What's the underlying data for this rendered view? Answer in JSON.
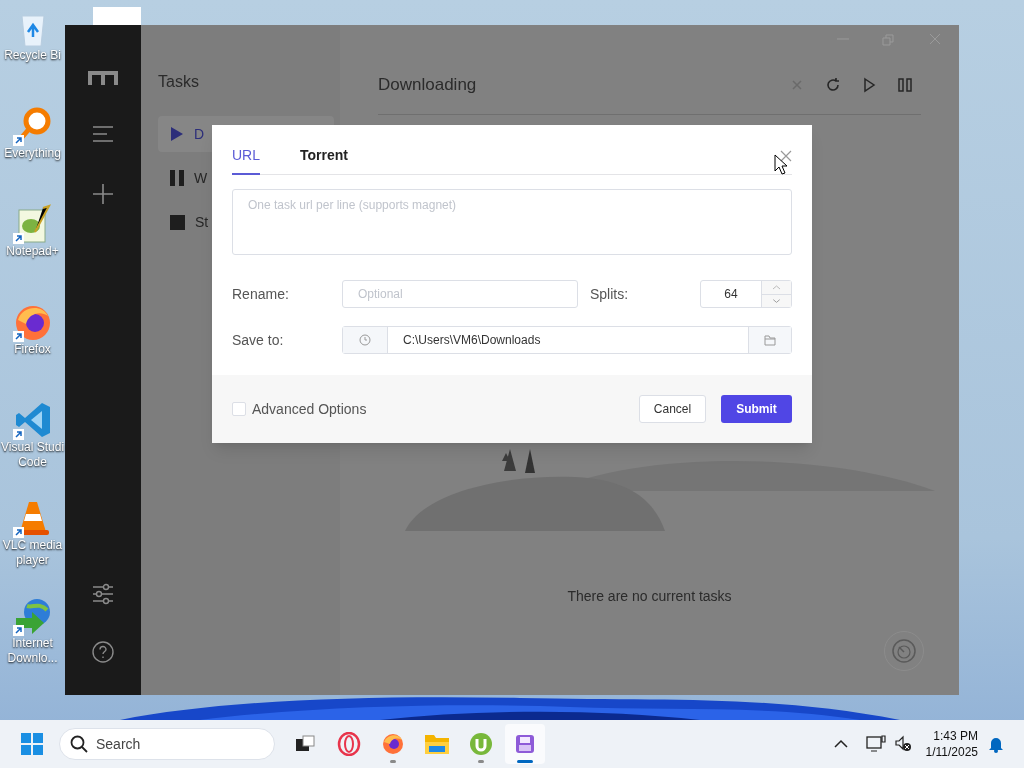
{
  "desktop": {
    "icons": [
      {
        "kind": "recycle",
        "lines": [
          "Recycle Bi"
        ],
        "shortcut": false
      },
      {
        "kind": "search",
        "lines": [
          "Everything"
        ],
        "shortcut": true
      },
      {
        "kind": "notepad",
        "lines": [
          "Notepad+"
        ],
        "shortcut": true
      },
      {
        "kind": "firefox",
        "lines": [
          "Firefox"
        ],
        "shortcut": true
      },
      {
        "kind": "vscode",
        "lines": [
          "Visual Studi",
          "Code"
        ],
        "shortcut": true
      },
      {
        "kind": "vlc",
        "lines": [
          "VLC media",
          "player"
        ],
        "shortcut": true
      },
      {
        "kind": "idm",
        "lines": [
          "Internet",
          "Downlo..."
        ],
        "shortcut": true
      }
    ]
  },
  "window": {
    "task_list": {
      "title": "Tasks",
      "items": [
        {
          "kind": "play",
          "label": "D",
          "selected": true
        },
        {
          "kind": "pause",
          "label": "W",
          "selected": false
        },
        {
          "kind": "stop",
          "label": "St",
          "selected": false
        }
      ]
    },
    "main": {
      "title": "Downloading",
      "empty_text": "There are no current tasks"
    }
  },
  "dialog": {
    "tabs": [
      {
        "label": "URL",
        "selected": true
      },
      {
        "label": "Torrent",
        "selected": false
      }
    ],
    "url_placeholder": "One task url per line (supports magnet)",
    "rename": {
      "label": "Rename:",
      "placeholder": "Optional"
    },
    "splits": {
      "label": "Splits:",
      "value": "64"
    },
    "save_to": {
      "label": "Save to:",
      "value": "C:\\Users\\VM6\\Downloads"
    },
    "advanced": {
      "label": "Advanced Options",
      "checked": false
    },
    "cancel": "Cancel",
    "submit": "Submit"
  },
  "taskbar": {
    "search_placeholder": "Search",
    "apps": [
      {
        "kind": "taskview",
        "running": false,
        "selected": false
      },
      {
        "kind": "opera",
        "running": false,
        "selected": false
      },
      {
        "kind": "firefox",
        "running": true,
        "selected": false
      },
      {
        "kind": "files",
        "running": false,
        "selected": false
      },
      {
        "kind": "utorrent",
        "running": true,
        "selected": false
      },
      {
        "kind": "motrix",
        "running": true,
        "selected": true
      }
    ],
    "time": "1:43 PM",
    "date": "1/11/2025"
  }
}
